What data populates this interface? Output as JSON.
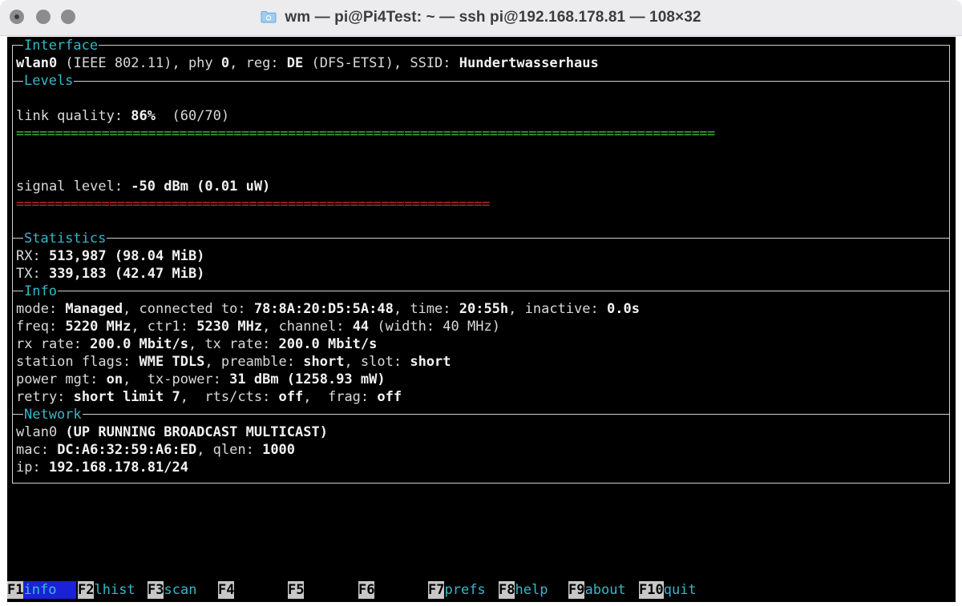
{
  "window": {
    "title": "wm — pi@Pi4Test: ~ — ssh pi@192.168.178.81 — 108×32"
  },
  "sections": {
    "interface": "Interface",
    "levels": "Levels",
    "statistics": "Statistics",
    "info": "Info",
    "network": "Network"
  },
  "interface": {
    "iface": "wlan0",
    "t1": " (IEEE 802.11), phy ",
    "phy": "0",
    "t2": ", reg: ",
    "reg": "DE",
    "t3": " (DFS-ETSI), SSID: ",
    "ssid": "Hundertwasserhaus"
  },
  "levels": {
    "link_label": "link quality: ",
    "link_pct": "86%",
    "link_raw": "  (60/70)",
    "link_quality_fraction": 0.857,
    "signal_label": "signal level: ",
    "signal_value": "-50 dBm (0.01 uW)",
    "signal_fraction": 0.583,
    "colors": {
      "link_bar": "#3fbf3a",
      "signal_bar": "#c8262a"
    }
  },
  "statistics": {
    "rx_label": "RX: ",
    "rx_value": "513,987 (98.04 MiB)",
    "tx_label": "TX: ",
    "tx_value": "339,183 (42.47 MiB)"
  },
  "info": {
    "l1": {
      "a": "mode: ",
      "b": "Managed",
      "c": ", connected to: ",
      "d": "78:8A:20:D5:5A:48",
      "e": ", time: ",
      "f": "20:55h",
      "g": ", inactive: ",
      "h": "0.0s"
    },
    "l2": {
      "a": "freq: ",
      "b": "5220 MHz",
      "c": ", ctr1: ",
      "d": "5230 MHz",
      "e": ", channel: ",
      "f": "44",
      "g": " (width: 40 MHz)"
    },
    "l3": {
      "a": "rx rate: ",
      "b": "200.0 Mbit/s",
      "c": ", tx rate: ",
      "d": "200.0 Mbit/s"
    },
    "l4": {
      "a": "station flags: ",
      "b": "WME TDLS",
      "c": ", preamble: ",
      "d": "short",
      "e": ", slot: ",
      "f": "short"
    },
    "l5": {
      "a": "power mgt: ",
      "b": "on",
      "c": ",  tx-power: ",
      "d": "31 dBm (1258.93 mW)"
    },
    "l6": {
      "a": "retry: ",
      "b": "short limit 7",
      "c": ",  rts/cts: ",
      "d": "off",
      "e": ",  frag: ",
      "f": "off"
    }
  },
  "network": {
    "l1a": "wlan0 ",
    "l1b": "(UP RUNNING BROADCAST MULTICAST)",
    "l2a": "mac: ",
    "l2b": "DC:A6:32:59:A6:ED",
    "l2c": ", qlen: ",
    "l2d": "1000",
    "l3a": "ip: ",
    "l3b": "192.168.178.81/24"
  },
  "fkeys": [
    {
      "num": "F1",
      "label": "info",
      "active": true
    },
    {
      "num": "F2",
      "label": "lhist"
    },
    {
      "num": "F3",
      "label": "scan"
    },
    {
      "num": "F4",
      "label": ""
    },
    {
      "num": "F5",
      "label": ""
    },
    {
      "num": "F6",
      "label": ""
    },
    {
      "num": "F7",
      "label": "prefs"
    },
    {
      "num": "F8",
      "label": "help"
    },
    {
      "num": "F9",
      "label": "about"
    },
    {
      "num": "F10",
      "label": "quit"
    }
  ],
  "icons": {
    "title": "folder-icon"
  }
}
